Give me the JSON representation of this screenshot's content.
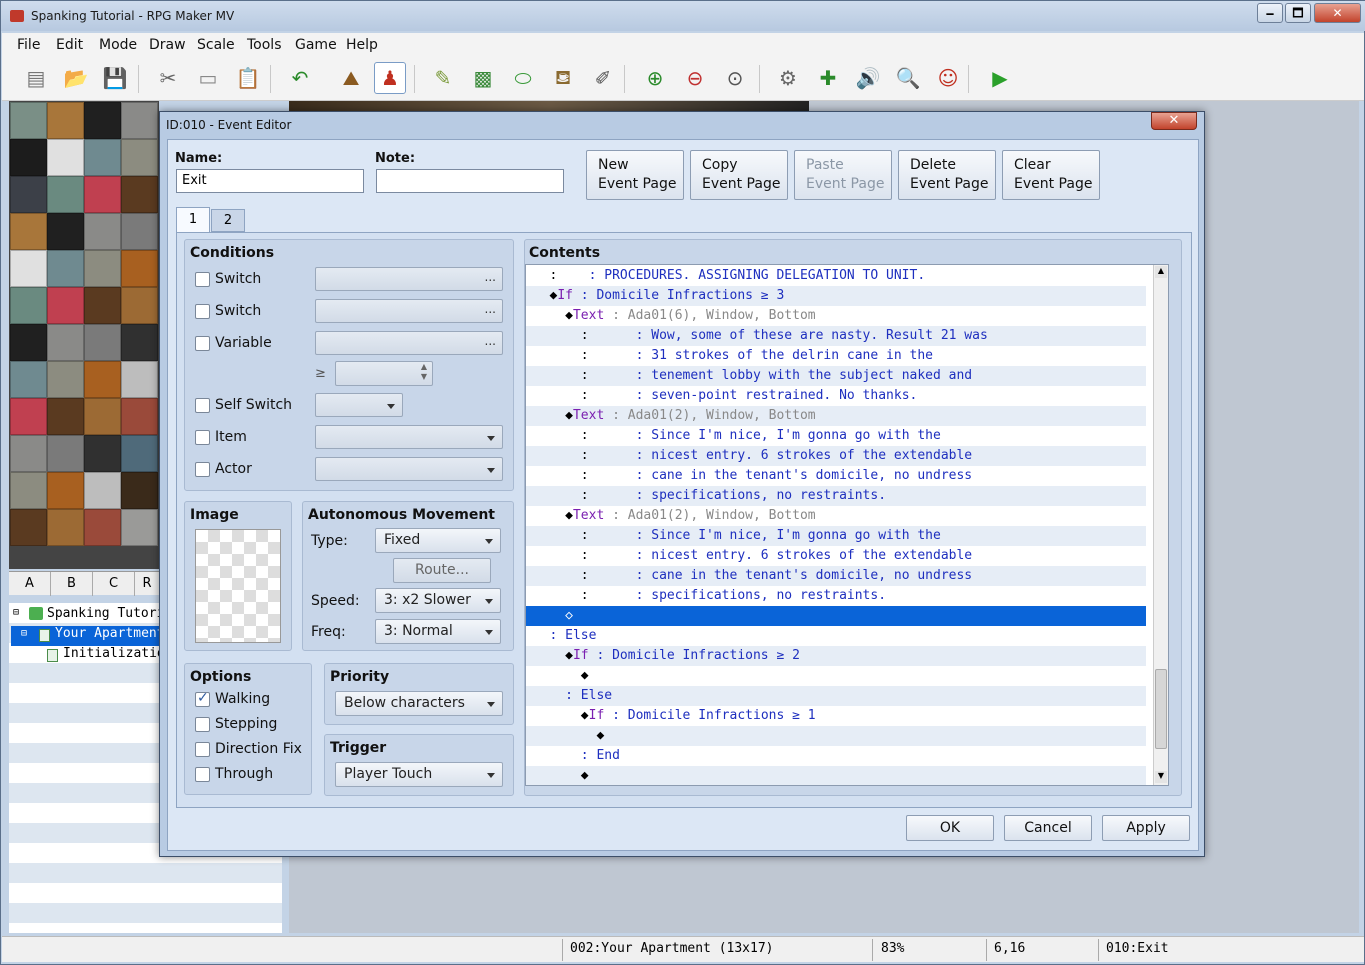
{
  "app": {
    "title": "Spanking Tutorial - RPG Maker MV",
    "min": "🗕",
    "max": "🗖",
    "close": "✕"
  },
  "menu": [
    "File",
    "Edit",
    "Mode",
    "Draw",
    "Scale",
    "Tools",
    "Game",
    "Help"
  ],
  "toolbar_icons": [
    "new-project-icon",
    "open-project-icon",
    "save-project-icon",
    "cut-icon",
    "copy-icon",
    "paste-icon",
    "undo-icon",
    "map-mode-icon",
    "event-mode-icon",
    "pencil-icon",
    "rectangle-icon",
    "ellipse-icon",
    "fill-icon",
    "shadow-pen-icon",
    "zoom-in-icon",
    "zoom-out-icon",
    "zoom-actual-icon",
    "database-icon",
    "plugin-manager-icon",
    "sound-test-icon",
    "event-searcher-icon",
    "character-generator-icon",
    "playtest-icon"
  ],
  "toolbar_glyphs": [
    "▤",
    "📂",
    "💾",
    "✂",
    "▭",
    "📋",
    "↶",
    "⛰",
    "♟",
    "✎",
    "▩",
    "⬭",
    "⛾",
    "✐",
    "⊕",
    "⊖",
    "⊙",
    "⚙",
    "✚",
    "🔊",
    "🔍",
    "☺",
    "▶"
  ],
  "tileTabs": [
    "A",
    "B",
    "C",
    "R"
  ],
  "tree": {
    "project": "Spanking Tutorial",
    "map": "Your Apartment",
    "child": "Initialization"
  },
  "status": {
    "map": "002:Your Apartment (13x17)",
    "zoom": "83%",
    "coord": "6,16",
    "event": "010:Exit"
  },
  "dialog": {
    "title": "ID:010 - Event Editor",
    "close": "✕",
    "name_label": "Name:",
    "name_value": "Exit",
    "note_label": "Note:",
    "note_value": "",
    "buttons": {
      "new1": "New",
      "new2": "Event Page",
      "copy1": "Copy",
      "copy2": "Event Page",
      "paste1": "Paste",
      "paste2": "Event Page",
      "del1": "Delete",
      "del2": "Event Page",
      "clear1": "Clear",
      "clear2": "Event Page"
    },
    "tabs": [
      "1",
      "2"
    ],
    "conditions": {
      "title": "Conditions",
      "switch1": "Switch",
      "switch2": "Switch",
      "variable": "Variable",
      "geq": "≥",
      "selfswitch": "Self Switch",
      "item": "Item",
      "actor": "Actor",
      "ellipsis": "..."
    },
    "image": {
      "title": "Image"
    },
    "movement": {
      "title": "Autonomous Movement",
      "type_label": "Type:",
      "type_value": "Fixed",
      "route": "Route...",
      "speed_label": "Speed:",
      "speed_value": "3: x2 Slower",
      "freq_label": "Freq:",
      "freq_value": "3: Normal"
    },
    "options": {
      "title": "Options",
      "walking": "Walking",
      "stepping": "Stepping",
      "dirfix": "Direction Fix",
      "through": "Through"
    },
    "priority": {
      "title": "Priority",
      "value": "Below characters"
    },
    "trigger": {
      "title": "Trigger",
      "value": "Player Touch"
    },
    "contents_title": "Contents",
    "ok": "OK",
    "cancel": "Cancel",
    "apply": "Apply"
  },
  "contents": [
    {
      "i": "  :",
      "m": "    : PROCEDURES. ASSIGNING DELEGATION TO UNIT.",
      "c": "blue"
    },
    {
      "i": "◆",
      "k": "If",
      "m": " : Domicile Infractions ≥ 3",
      "c": "blue",
      "ind": 2
    },
    {
      "i": "◆",
      "k": "Text",
      "m": " : Ada01(6), Window, Bottom",
      "c": "gray",
      "ind": 4
    },
    {
      "i": "  :",
      "m": "      : Wow, some of these are nasty. Result 21 was",
      "c": "blue",
      "ind": 4
    },
    {
      "i": "  :",
      "m": "      : 31 strokes of the delrin cane in the",
      "c": "blue",
      "ind": 4
    },
    {
      "i": "  :",
      "m": "      : tenement lobby with the subject naked and",
      "c": "blue",
      "ind": 4
    },
    {
      "i": "  :",
      "m": "      : seven-point restrained. No thanks.",
      "c": "blue",
      "ind": 4
    },
    {
      "i": "◆",
      "k": "Text",
      "m": " : Ada01(2), Window, Bottom",
      "c": "gray",
      "ind": 4
    },
    {
      "i": "  :",
      "m": "      : Since I'm nice, I'm gonna go with the",
      "c": "blue",
      "ind": 4
    },
    {
      "i": "  :",
      "m": "      : nicest entry. 6 strokes of the extendable",
      "c": "blue",
      "ind": 4
    },
    {
      "i": "  :",
      "m": "      : cane in the tenant's domicile, no undress",
      "c": "blue",
      "ind": 4
    },
    {
      "i": "  :",
      "m": "      : specifications, no restraints.",
      "c": "blue",
      "ind": 4
    },
    {
      "i": "◆",
      "k": "Text",
      "m": " : Ada01(2), Window, Bottom",
      "c": "gray",
      "ind": 4
    },
    {
      "i": "  :",
      "m": "      : Since I'm nice, I'm gonna go with the",
      "c": "blue",
      "ind": 4
    },
    {
      "i": "  :",
      "m": "      : nicest entry. 6 strokes of the extendable",
      "c": "blue",
      "ind": 4
    },
    {
      "i": "  :",
      "m": "      : cane in the tenant's domicile, no undress",
      "c": "blue",
      "ind": 4
    },
    {
      "i": "  :",
      "m": "      : specifications, no restraints.",
      "c": "blue",
      "ind": 4
    },
    {
      "i": "◇",
      "m": "",
      "c": "sel",
      "ind": 4
    },
    {
      "i": "",
      "k": ": Else",
      "m": "",
      "c": "blue",
      "ind": 2
    },
    {
      "i": "◆",
      "k": "If",
      "m": " : Domicile Infractions ≥ 2",
      "c": "blue",
      "ind": 4
    },
    {
      "i": "◆",
      "m": "",
      "c": "",
      "ind": 6
    },
    {
      "i": "",
      "k": ": Else",
      "m": "",
      "c": "blue",
      "ind": 4
    },
    {
      "i": "◆",
      "k": "If",
      "m": " : Domicile Infractions ≥ 1",
      "c": "blue",
      "ind": 6
    },
    {
      "i": "◆",
      "m": "",
      "c": "",
      "ind": 8
    },
    {
      "i": "",
      "k": ": End",
      "m": "",
      "c": "blue",
      "ind": 6
    },
    {
      "i": "◆",
      "m": "",
      "c": "",
      "ind": 6
    }
  ]
}
